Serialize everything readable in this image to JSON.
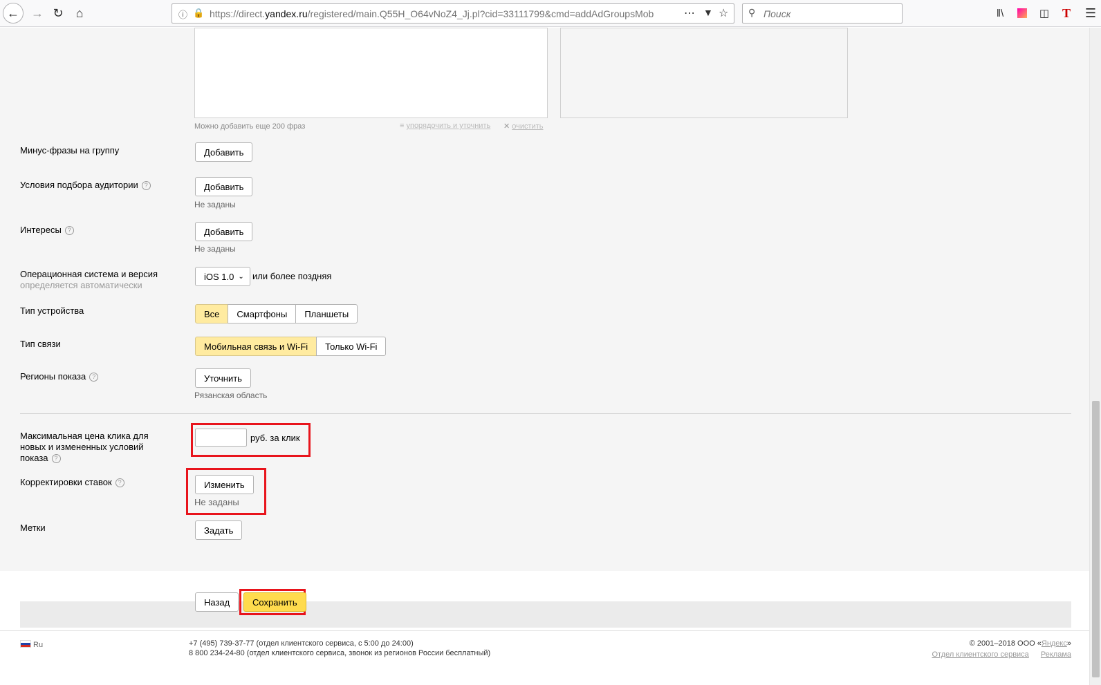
{
  "browser": {
    "url_prefix": "https://direct.",
    "url_domain": "yandex.ru",
    "url_rest": "/registered/main.Q55H_O64vNoZ4_Jj.pl?cid=33111799&cmd=addAdGroupsMob",
    "search_placeholder": "Поиск"
  },
  "phrases": {
    "hint": "Можно добавить еще 200 фраз",
    "sort_link": "упорядочить и уточнить",
    "clear_link": "очистить"
  },
  "rows": {
    "minus_phrases": {
      "label": "Минус-фразы на группу",
      "button": "Добавить"
    },
    "audience": {
      "label": "Условия подбора аудитории",
      "button": "Добавить",
      "note": "Не заданы"
    },
    "interests": {
      "label": "Интересы",
      "button": "Добавить",
      "note": "Не заданы"
    },
    "os": {
      "label": "Операционная система и версия",
      "sublabel": "определяется автоматически",
      "select_value": "iOS 1.0",
      "suffix": "или более поздняя"
    },
    "device": {
      "label": "Тип устройства",
      "options": [
        "Все",
        "Смартфоны",
        "Планшеты"
      ],
      "selected": "Все"
    },
    "connection": {
      "label": "Тип связи",
      "options": [
        "Мобильная связь и Wi-Fi",
        "Только Wi-Fi"
      ],
      "selected": "Мобильная связь и Wi-Fi"
    },
    "regions": {
      "label": "Регионы показа",
      "button": "Уточнить",
      "note": "Рязанская область"
    },
    "max_price": {
      "label_line1": "Максимальная цена клика для",
      "label_line2": "новых и измененных условий",
      "label_line3": "показа",
      "input_value": "",
      "suffix": "руб. за клик"
    },
    "bid_adjust": {
      "label": "Корректировки ставок",
      "button": "Изменить",
      "note": "Не заданы"
    },
    "tags": {
      "label": "Метки",
      "button": "Задать"
    }
  },
  "actions": {
    "back": "Назад",
    "save": "Сохранить"
  },
  "footer": {
    "lang": "Ru",
    "phone1": "+7 (495) 739-37-77 (отдел клиентского сервиса, с 5:00 до 24:00)",
    "phone2": "8 800 234-24-80 (отдел клиентского сервиса, звонок из регионов России бесплатный)",
    "copyright_prefix": "© 2001–2018 ООО «",
    "copyright_link": "Яндекс",
    "copyright_suffix": "»",
    "link_support": "Отдел клиентского сервиса",
    "link_ads": "Реклама"
  },
  "colors": {
    "highlight": "#e8141c",
    "selected": "#ffeba0",
    "save": "#ffdb4d"
  }
}
